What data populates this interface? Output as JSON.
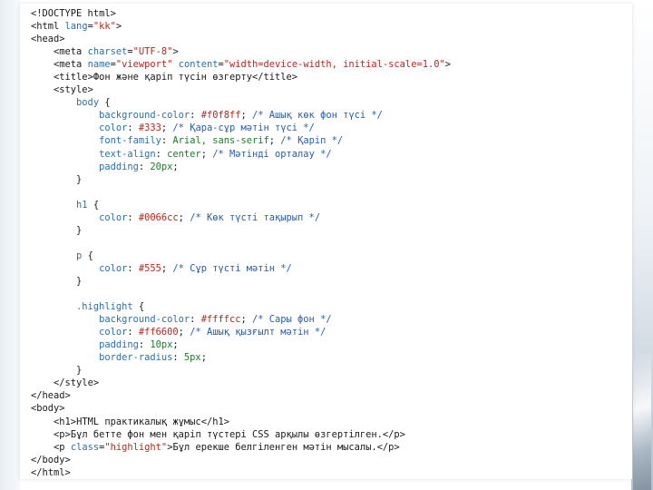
{
  "slide": {
    "title": "Фон және қаріп түсін өзгерту"
  },
  "code": {
    "doctype": "<!DOCTYPE html>",
    "html_open_tag": "<html ",
    "html_lang_attr": "lang",
    "html_lang_eq": "=",
    "html_lang_val": "\"kk\"",
    "html_open_close": ">",
    "head_open": "<head>",
    "meta1_tag": "<meta ",
    "meta1_attr": "charset",
    "meta1_eq": "=",
    "meta1_val": "\"UTF-8\"",
    "meta1_close": ">",
    "meta2_tag": "<meta ",
    "meta2_attr1": "name",
    "meta2_eq1": "=",
    "meta2_val1": "\"viewport\"",
    "meta2_attr2": " content",
    "meta2_eq2": "=",
    "meta2_val2": "\"width=device-width, initial-scale=1.0\"",
    "meta2_close": ">",
    "title_open": "<title>",
    "title_text": "Фон және қаріп түсін өзгерту",
    "title_close": "</title>",
    "style_open": "<style>",
    "body_sel": "body ",
    "brace_open": "{",
    "body_bg_prop": "background-color",
    "body_bg_val": "#f0f8ff",
    "body_bg_cmt": "/* Ашық көк фон түсі */",
    "body_color_prop": "color",
    "body_color_val": "#333",
    "body_color_cmt": "/* Қара-сұр мәтін түсі */",
    "body_font_prop": "font-family",
    "body_font_val": "Arial, sans-serif",
    "body_font_cmt": "/* Қаріп */",
    "body_align_prop": "text-align",
    "body_align_val": "center",
    "body_align_cmt": "/* Мәтінді орталау */",
    "body_pad_prop": "padding",
    "body_pad_val": "20px",
    "brace_close": "}",
    "h1_sel": "h1 ",
    "h1_color_prop": "color",
    "h1_color_val": "#0066cc",
    "h1_color_cmt": "/* Көк түсті тақырып */",
    "p_sel": "p ",
    "p_color_prop": "color",
    "p_color_val": "#555",
    "p_color_cmt": "/* Сұр түсті мәтін */",
    "hl_sel": ".highlight ",
    "hl_bg_prop": "background-color",
    "hl_bg_val": "#ffffcc",
    "hl_bg_cmt": "/* Сары фон */",
    "hl_color_prop": "color",
    "hl_color_val": "#ff6600",
    "hl_color_cmt": "/* Ашық қызғылт мәтін */",
    "hl_pad_prop": "padding",
    "hl_pad_val": "10px",
    "hl_rad_prop": "border-radius",
    "hl_rad_val": "5px",
    "style_close": "</style>",
    "head_close": "</head>",
    "body_open": "<body>",
    "h1_open": "<h1>",
    "h1_text": "HTML практикалық жұмыс",
    "h1_close": "</h1>",
    "p1_open": "<p>",
    "p1_text": "Бұл бетте фон мен қаріп түстері CSS арқылы өзгертілген.",
    "p1_close": "</p>",
    "p2_tag": "<p ",
    "p2_attr": "class",
    "p2_eq": "=",
    "p2_val": "\"highlight\"",
    "p2_gt": ">",
    "p2_text": "Бұл ерекше белгіленген мәтін мысалы.",
    "p2_close": "</p>",
    "body_close": "</body>",
    "html_close": "</html>",
    "colon": ": ",
    "semi": "; "
  }
}
